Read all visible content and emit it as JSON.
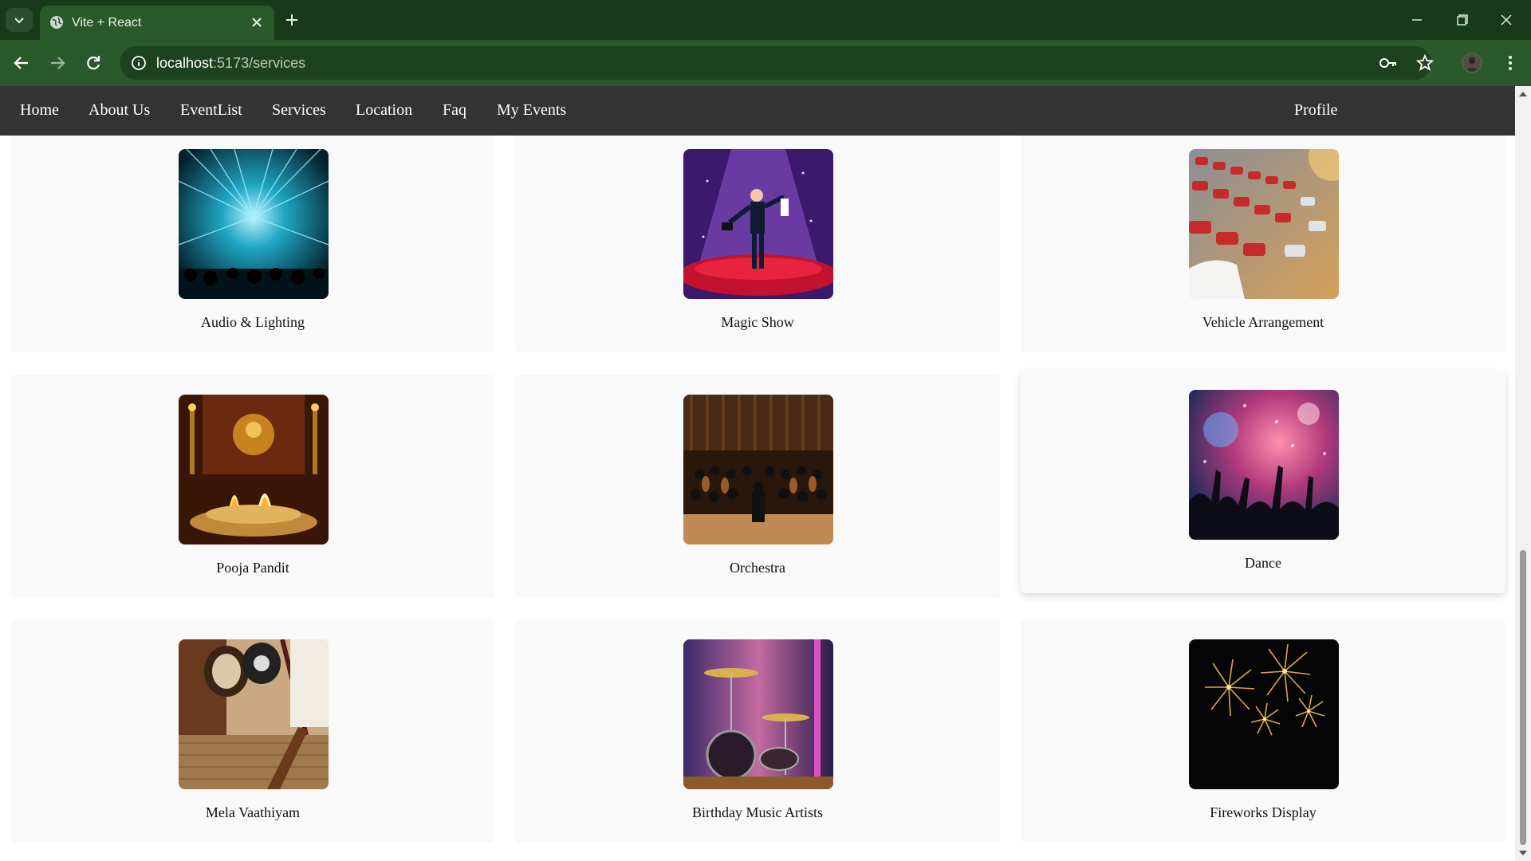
{
  "browser": {
    "tab_title": "Vite + React",
    "url_host": "localhost",
    "url_path": ":5173/services"
  },
  "site_nav": {
    "links": [
      "Home",
      "About Us",
      "EventList",
      "Services",
      "Location",
      "Faq",
      "My Events"
    ],
    "profile": "Profile"
  },
  "services": [
    {
      "name": "Audio & Lighting",
      "icon": "concert-lights-image"
    },
    {
      "name": "Magic Show",
      "icon": "magician-image"
    },
    {
      "name": "Vehicle Arrangement",
      "icon": "parked-cars-image"
    },
    {
      "name": "Pooja Pandit",
      "icon": "oil-lamps-image"
    },
    {
      "name": "Orchestra",
      "icon": "orchestra-image"
    },
    {
      "name": "Dance",
      "icon": "dance-crowd-image"
    },
    {
      "name": "Mela Vaathiyam",
      "icon": "drums-image"
    },
    {
      "name": "Birthday Music Artists",
      "icon": "drum-kit-image"
    },
    {
      "name": "Fireworks Display",
      "icon": "fireworks-image"
    }
  ],
  "colors": {
    "tabstrip": "#173a1b",
    "toolbar": "#2a5a2c",
    "site_nav": "#333333",
    "card": "#f9f9f9"
  }
}
